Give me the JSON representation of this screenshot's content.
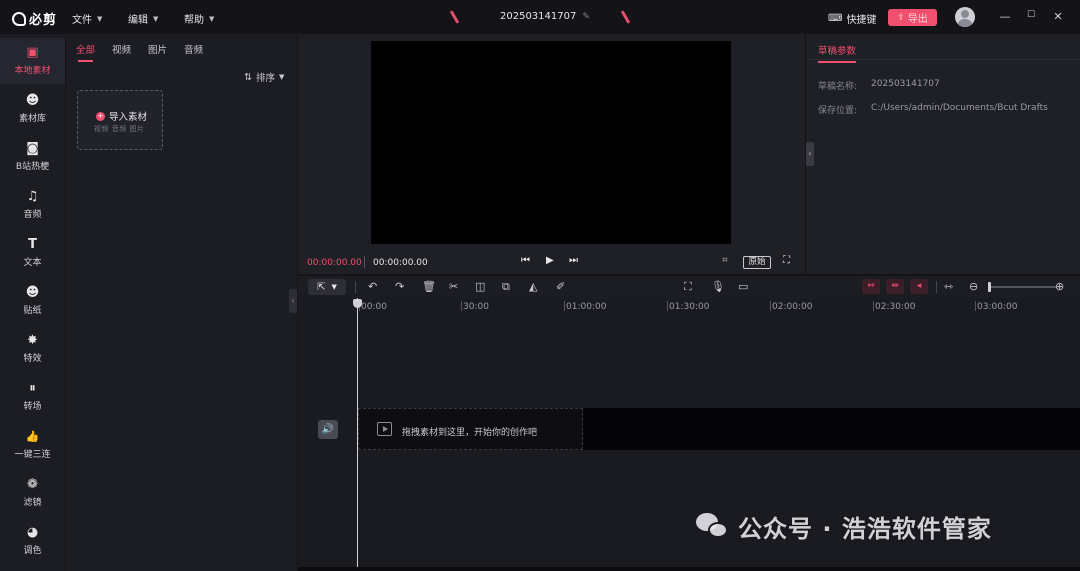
{
  "app": {
    "logo_text": "必剪"
  },
  "menu": [
    {
      "label": "文件"
    },
    {
      "label": "编辑"
    },
    {
      "label": "帮助"
    }
  ],
  "project": {
    "title": "202503141707"
  },
  "header": {
    "shortcut_label": "快捷键",
    "export_label": "导出"
  },
  "window": {
    "minimize": "—",
    "maximize": "☐",
    "close": "✕"
  },
  "sidebar": {
    "items": [
      {
        "label": "本地素材",
        "icon": "upload-box-icon",
        "glyph": "▣"
      },
      {
        "label": "素材库",
        "icon": "face-icon",
        "glyph": "☻"
      },
      {
        "label": "B站热梗",
        "icon": "tv-icon",
        "glyph": "◙"
      },
      {
        "label": "音频",
        "icon": "music-note-icon",
        "glyph": "♫"
      },
      {
        "label": "文本",
        "icon": "text-t-icon",
        "glyph": "T"
      },
      {
        "label": "贴纸",
        "icon": "sticker-icon",
        "glyph": "☻"
      },
      {
        "label": "特效",
        "icon": "effects-star-icon",
        "glyph": "✸"
      },
      {
        "label": "转场",
        "icon": "transition-icon",
        "glyph": "⏸"
      },
      {
        "label": "一键三连",
        "icon": "thumbs-up-icon",
        "glyph": "👍"
      },
      {
        "label": "滤镜",
        "icon": "filter-circles-icon",
        "glyph": "❁"
      },
      {
        "label": "调色",
        "icon": "palette-icon",
        "glyph": "◕"
      }
    ]
  },
  "media": {
    "tabs": [
      {
        "label": "全部"
      },
      {
        "label": "视频"
      },
      {
        "label": "图片"
      },
      {
        "label": "音频"
      }
    ],
    "sort_label": "排序",
    "import_title": "导入素材",
    "import_sub": "视频 音频 图片"
  },
  "preview": {
    "current_time": "00:00:00.00",
    "total_time": "00:00:00.00",
    "ratio_label": "原始"
  },
  "params": {
    "tab": "草稿参数",
    "rows": [
      {
        "key": "草稿名称:",
        "value": "202503141707"
      },
      {
        "key": "保存位置:",
        "value": "C:/Users/admin/Documents/Bcut Drafts"
      }
    ]
  },
  "timeline": {
    "ruler": [
      "00:00",
      "30:00",
      "01:00:00",
      "01:30:00",
      "02:00:00",
      "02:30:00",
      "03:00:00"
    ],
    "drop_hint": "拖拽素材到这里，开始你的创作吧"
  },
  "watermark": {
    "text": "公众号 · 浩浩软件管家"
  },
  "colors": {
    "accent": "#f0506e",
    "bg": "#131318",
    "panel": "#1c1c23"
  }
}
